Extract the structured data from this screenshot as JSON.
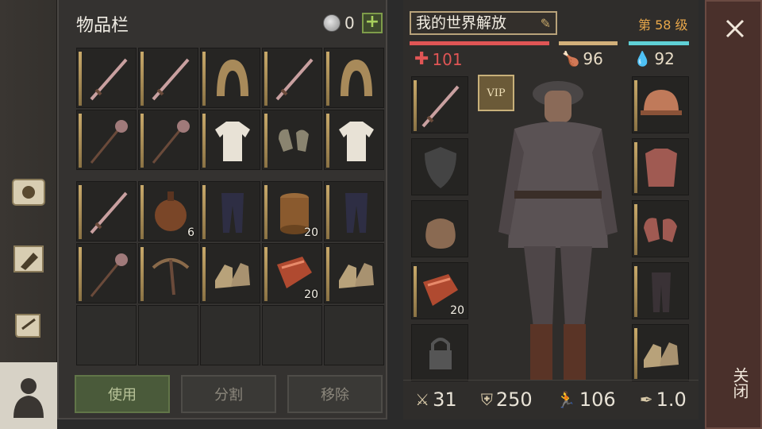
{
  "inventory": {
    "title": "物品栏",
    "currency": "0",
    "rows": [
      [
        {
          "icon": "sword-icon",
          "qty": ""
        },
        {
          "icon": "sword-icon",
          "qty": ""
        },
        {
          "icon": "hood-icon",
          "qty": ""
        },
        {
          "icon": "sword-icon",
          "qty": ""
        },
        {
          "icon": "hood-icon",
          "qty": ""
        }
      ],
      [
        {
          "icon": "mace-icon",
          "qty": ""
        },
        {
          "icon": "mace-icon",
          "qty": ""
        },
        {
          "icon": "shirt-icon",
          "qty": ""
        },
        {
          "icon": "gloves-icon",
          "qty": ""
        },
        {
          "icon": "shirt-icon",
          "qty": ""
        }
      ],
      [
        {
          "icon": "sword-icon",
          "qty": ""
        },
        {
          "icon": "flask-icon",
          "qty": "6"
        },
        {
          "icon": "pants-icon",
          "qty": ""
        },
        {
          "icon": "barrel-icon",
          "qty": "20"
        },
        {
          "icon": "pants-icon",
          "qty": ""
        }
      ],
      [
        {
          "icon": "mace-icon",
          "qty": ""
        },
        {
          "icon": "crossbow-icon",
          "qty": ""
        },
        {
          "icon": "boots-icon",
          "qty": ""
        },
        {
          "icon": "meat-icon",
          "qty": "20"
        },
        {
          "icon": "boots-icon",
          "qty": ""
        }
      ]
    ],
    "buttons": {
      "use": "使用",
      "split": "分割",
      "remove": "移除"
    }
  },
  "character": {
    "name": "我的世界解放",
    "level": "第 58 级",
    "health": "101",
    "hunger": "96",
    "thirst": "92",
    "vip": "VIP",
    "left_slots": [
      {
        "icon": "sword-icon",
        "qty": ""
      },
      {
        "icon": "shield-icon",
        "qty": ""
      },
      {
        "icon": "bag-icon",
        "qty": ""
      },
      {
        "icon": "meat-icon",
        "qty": "20"
      },
      {
        "icon": "lock-icon",
        "qty": ""
      }
    ],
    "right_slots": [
      "helmet-icon",
      "chainmail-icon",
      "mail-gloves-icon",
      "mail-pants-icon",
      "boots-icon"
    ],
    "attack": "31",
    "defense": "250",
    "speed": "106",
    "weight": "1.0"
  },
  "close_label": "关闭",
  "colors": {
    "health": "#e05555",
    "hunger": "#d2b07a",
    "thirst": "#5fd0d6",
    "level": "#e8a74a"
  }
}
